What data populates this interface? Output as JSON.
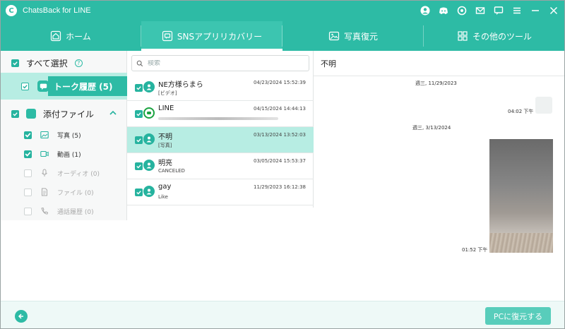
{
  "app": {
    "title": "ChatsBack for LINE",
    "logo": "C"
  },
  "window_controls": [
    "user-icon",
    "discord-icon",
    "settings-icon",
    "mail-icon",
    "feedback-icon",
    "menu-icon",
    "minimize-icon",
    "close-icon"
  ],
  "tabs": [
    {
      "label": "ホーム",
      "icon": "home-icon",
      "active": false
    },
    {
      "label": "SNSアプリリカバリー",
      "icon": "sns-recovery-icon",
      "active": true
    },
    {
      "label": "写真復元",
      "icon": "photo-restore-icon",
      "active": false
    },
    {
      "label": "その他のツール",
      "icon": "tools-icon",
      "active": false
    }
  ],
  "sidebar": {
    "select_all": "すべて選択",
    "talk_history": "トーク履歴 (5)",
    "attachments": "添付ファイル",
    "items": [
      {
        "label": "写真 (5)",
        "icon": "photo-icon",
        "checked": true
      },
      {
        "label": "動画 (1)",
        "icon": "video-icon",
        "checked": true
      },
      {
        "label": "オーディオ (0)",
        "icon": "microphone-icon",
        "checked": false
      },
      {
        "label": "ファイル (0)",
        "icon": "file-icon",
        "checked": false
      },
      {
        "label": "通話履歴 (0)",
        "icon": "phone-icon",
        "checked": false
      }
    ]
  },
  "search": {
    "placeholder": "検索",
    "value": ""
  },
  "conversations": [
    {
      "name": "NE方様らまら",
      "preview": "[ビデオ]",
      "time": "04/23/2024 15:52:39",
      "avatar": "user-avatar-icon",
      "selected": false
    },
    {
      "name": "LINE",
      "preview": "",
      "time": "04/15/2024 14:44:13",
      "avatar": "line-avatar-icon",
      "selected": false
    },
    {
      "name": "不明",
      "preview": "[写真]",
      "time": "03/13/2024 13:52:03",
      "avatar": "user-avatar-icon",
      "selected": true
    },
    {
      "name": "明亮",
      "preview": "CANCELED",
      "time": "03/05/2024 15:53:37",
      "avatar": "user-avatar-icon",
      "selected": false
    },
    {
      "name": "gay",
      "preview": "Like",
      "time": "11/29/2023 16:12:38",
      "avatar": "user-avatar-icon",
      "selected": false
    }
  ],
  "chat": {
    "title": "不明",
    "date1": "週三, 11/29/2023",
    "time1": "04:02 下午",
    "date2": "週三, 3/13/2024",
    "time2": "01:52 下午"
  },
  "footer": {
    "restore_label": "PCに復元する"
  },
  "colors": {
    "accent": "#2dbba5",
    "selected": "#b7ede3"
  }
}
